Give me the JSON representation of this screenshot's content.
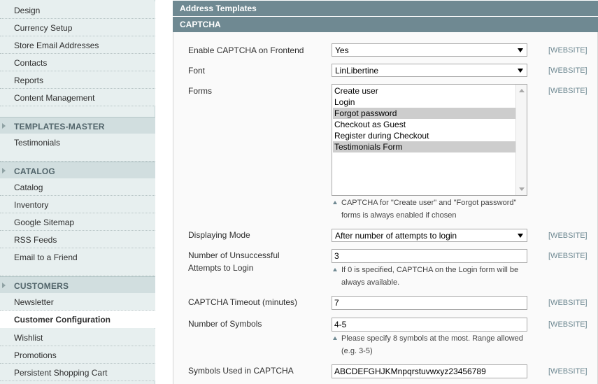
{
  "sidebar": {
    "items_top": [
      "Design",
      "Currency Setup",
      "Store Email Addresses",
      "Contacts",
      "Reports",
      "Content Management"
    ],
    "sections": [
      {
        "title": "TEMPLATES-MASTER",
        "items": [
          "Testimonials"
        ]
      },
      {
        "title": "CATALOG",
        "items": [
          "Catalog",
          "Inventory",
          "Google Sitemap",
          "RSS Feeds",
          "Email to a Friend"
        ]
      },
      {
        "title": "CUSTOMERS",
        "items": [
          "Newsletter",
          "Customer Configuration",
          "Wishlist",
          "Promotions",
          "Persistent Shopping Cart"
        ]
      }
    ],
    "active_item": "Customer Configuration"
  },
  "main": {
    "sections": [
      "Address Templates",
      "CAPTCHA"
    ],
    "scope_label": "[WEBSITE]",
    "fields": {
      "enable": {
        "label": "Enable CAPTCHA on Frontend",
        "value": "Yes"
      },
      "font": {
        "label": "Font",
        "value": "LinLibertine"
      },
      "forms": {
        "label": "Forms",
        "options": [
          {
            "label": "Create user",
            "selected": false
          },
          {
            "label": "Login",
            "selected": false
          },
          {
            "label": "Forgot password",
            "selected": true
          },
          {
            "label": "Checkout as Guest",
            "selected": false
          },
          {
            "label": "Register during Checkout",
            "selected": false
          },
          {
            "label": "Testimonials Form",
            "selected": true
          }
        ],
        "note_line1": "CAPTCHA for \"Create user\" and \"Forgot password\"",
        "note_line2": "forms is always enabled if chosen"
      },
      "mode": {
        "label": "Displaying Mode",
        "value": "After number of attempts to login"
      },
      "attempts": {
        "label_line1": "Number of Unsuccessful",
        "label_line2": "Attempts to Login",
        "value": "3",
        "note_line1": "If 0 is specified, CAPTCHA on the Login form will be",
        "note_line2": "always available."
      },
      "timeout": {
        "label": "CAPTCHA Timeout (minutes)",
        "value": "7"
      },
      "symbols": {
        "label": "Number of Symbols",
        "value": "4-5",
        "note_line1": "Please specify 8 symbols at the most. Range allowed",
        "note_line2": "(e.g. 3-5)"
      },
      "symbols_used": {
        "label": "Symbols Used in CAPTCHA",
        "value": "ABCDEFGHJKMnpqrstuvwxyz23456789"
      }
    }
  },
  "colors": {
    "section_header": "#6f8992",
    "sidebar_bg": "#e7efef",
    "sidebar_section_bg": "#d1dedf",
    "selected_option": "#cdcdcd"
  }
}
